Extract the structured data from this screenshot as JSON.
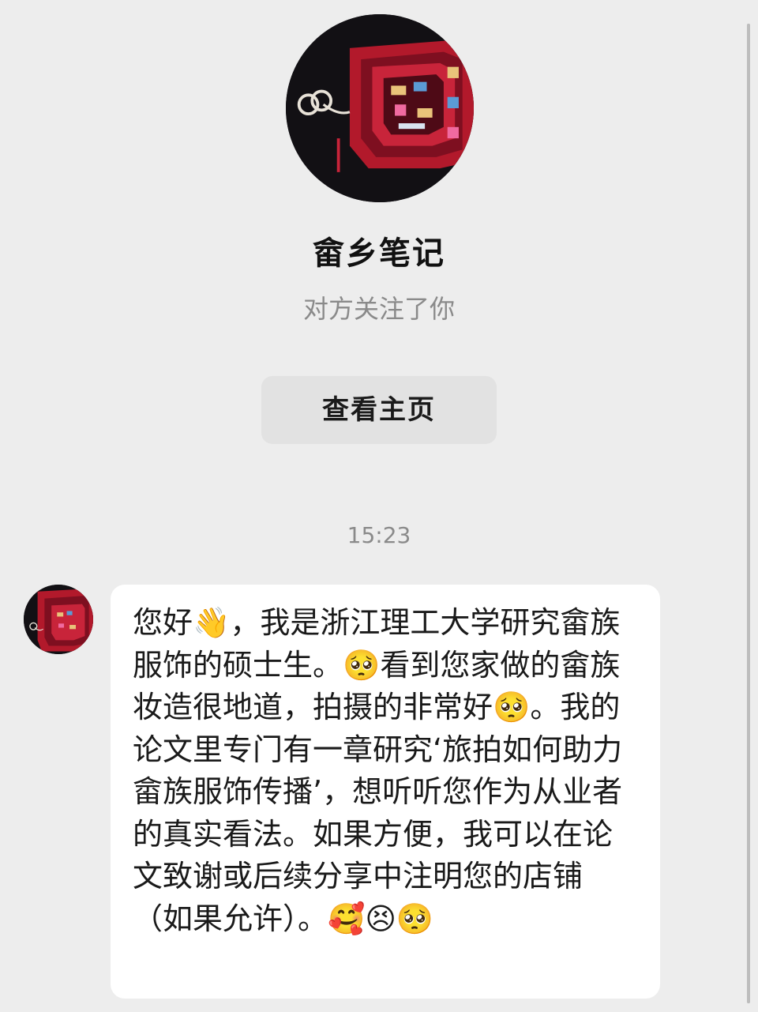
{
  "contact": {
    "name": "畲乡笔记",
    "follow_status": "对方关注了你",
    "view_profile_label": "查看主页"
  },
  "chat": {
    "timestamp": "15:23",
    "messages": [
      {
        "sender": "畲乡笔记",
        "text": "您好👋，我是浙江理工大学研究畲族服饰的硕士生。🥺看到您家做的畲族妆造很地道，拍摄的非常好🥺。我的论文里专门有一章研究‘旅拍如何助力畲族服饰传播’，想听听您作为从业者的真实看法。如果方便，我可以在论文致谢或后续分享中注明您的店铺（如果允许）。🥰😣🥺"
      }
    ]
  },
  "icons": {
    "profile_avatar": "embroidered-garment-photo",
    "message_avatar": "embroidered-garment-photo"
  },
  "colors": {
    "background": "#ededed",
    "bubble": "#ffffff",
    "button": "#e2e2e2",
    "muted_text": "#8a8a8a",
    "primary_text": "#1a1a1a"
  }
}
